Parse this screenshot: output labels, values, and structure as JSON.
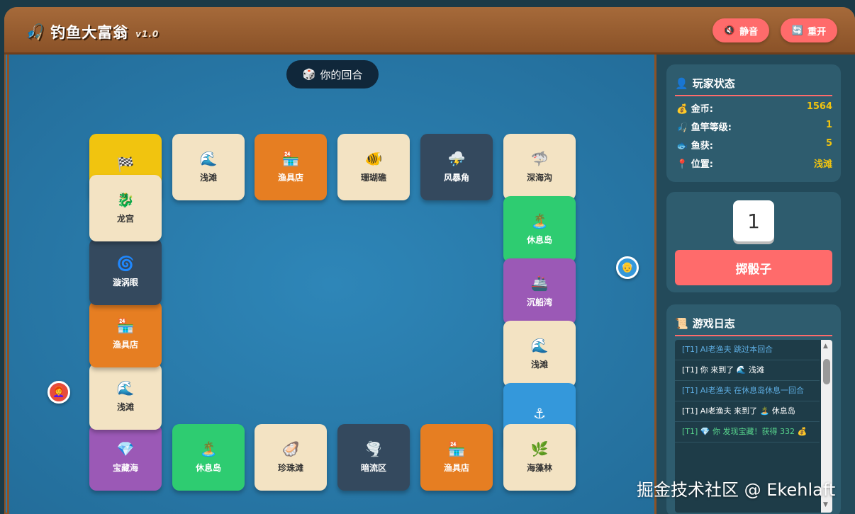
{
  "header": {
    "icon": "🎣",
    "title": "钓鱼大富翁",
    "version": "v1.0",
    "mute_icon": "🔇",
    "mute_label": "静音",
    "reset_icon": "🔄",
    "reset_label": "重开"
  },
  "turn": {
    "icon": "🎲",
    "label": "你的回合"
  },
  "tiles": [
    {
      "icon": "🏁",
      "label": "",
      "color": "yellow"
    },
    {
      "icon": "🌊",
      "label": "浅滩",
      "color": "cream"
    },
    {
      "icon": "🏪",
      "label": "渔具店",
      "color": "orange"
    },
    {
      "icon": "🐠",
      "label": "珊瑚礁",
      "color": "cream"
    },
    {
      "icon": "⛈️",
      "label": "风暴角",
      "color": "dark"
    },
    {
      "icon": "🦈",
      "label": "深海沟",
      "color": "cream"
    },
    {
      "icon": "🏝️",
      "label": "休息岛",
      "color": "green"
    },
    {
      "icon": "🚢",
      "label": "沉船湾",
      "color": "purple"
    },
    {
      "icon": "🌊",
      "label": "浅滩",
      "color": "cream"
    },
    {
      "icon": "⚓",
      "label": "",
      "color": "blue"
    },
    {
      "icon": "🌿",
      "label": "海藻林",
      "color": "cream"
    },
    {
      "icon": "🏪",
      "label": "渔具店",
      "color": "orange"
    },
    {
      "icon": "🌪️",
      "label": "暗流区",
      "color": "dark"
    },
    {
      "icon": "🦪",
      "label": "珍珠滩",
      "color": "cream"
    },
    {
      "icon": "🏝️",
      "label": "休息岛",
      "color": "green"
    },
    {
      "icon": "💎",
      "label": "宝藏海",
      "color": "purple"
    },
    {
      "icon": "🌊",
      "label": "浅滩",
      "color": "cream"
    },
    {
      "icon": "🏪",
      "label": "渔具店",
      "color": "orange"
    },
    {
      "icon": "🌀",
      "label": "漩涡眼",
      "color": "dark"
    },
    {
      "icon": "🐉",
      "label": "龙宫",
      "color": "cream"
    }
  ],
  "tokens": {
    "player": {
      "icon": "👩‍🦰",
      "color": "#e74c3c"
    },
    "ai": {
      "icon": "👴",
      "color": "#3498db"
    }
  },
  "status": {
    "title": "玩家状态",
    "title_icon": "👤",
    "rows": [
      {
        "icon": "💰",
        "label": "金币:",
        "value": "1564"
      },
      {
        "icon": "🎣",
        "label": "鱼竿等级:",
        "value": "1"
      },
      {
        "icon": "🐟",
        "label": "鱼获:",
        "value": "5"
      },
      {
        "icon": "📍",
        "label": "位置:",
        "value": "浅滩"
      }
    ]
  },
  "dice": {
    "value": "1",
    "button_label": "掷骰子"
  },
  "log": {
    "title": "游戏日志",
    "title_icon": "📜",
    "entries": [
      {
        "text": "[T1] AI老渔夫 跳过本回合",
        "kind": "ai"
      },
      {
        "text": "[T1] 你 来到了 🌊 浅滩",
        "kind": "player"
      },
      {
        "text": "[T1] AI老渔夫 在休息岛休息一回合",
        "kind": "ai"
      },
      {
        "text": "[T1] AI老渔夫 来到了 🏝️ 休息岛",
        "kind": "player"
      },
      {
        "text": "[T1] 💎 你 发现宝藏！获得 332 💰",
        "kind": "good"
      }
    ]
  },
  "watermark": "掘金技术社区 @ Ekehlaft",
  "colors": {
    "accent": "#ff6b6b",
    "gold": "#f1c40f",
    "board": "#2a7aa8",
    "header": "#9c6030",
    "cream": "#f3e3c3",
    "orange": "#e67e22",
    "dark": "#34495e",
    "green": "#2ecc71",
    "purple": "#9b59b6",
    "blue": "#3498db",
    "yellow": "#f1c40f"
  }
}
